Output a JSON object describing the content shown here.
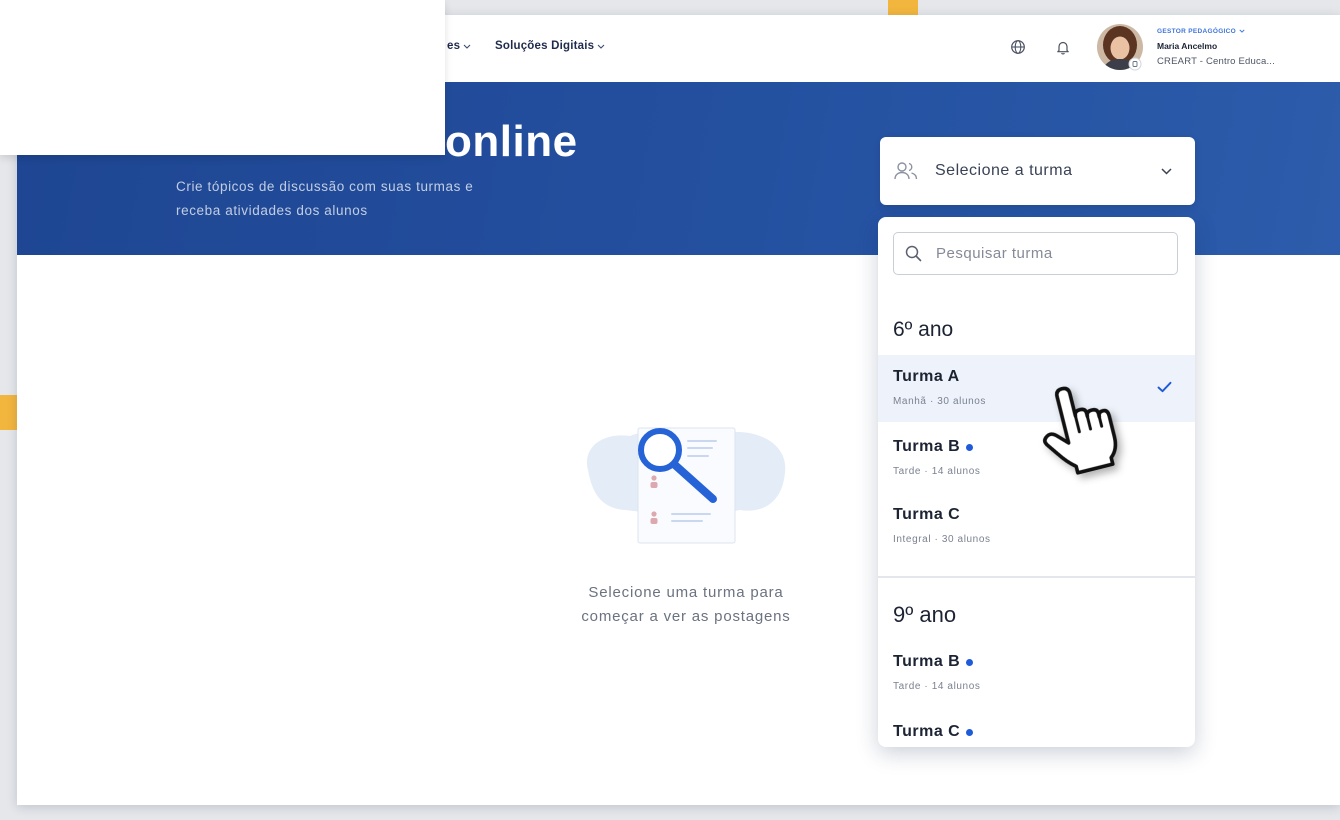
{
  "colors": {
    "page_bg": "#e5e7eb",
    "accent_yellow": "#f2b63e",
    "banner_start": "#1e4692",
    "banner_end": "#2c5cab",
    "accent_blue": "#1e5bd8",
    "selected_row": "#eef3fb",
    "text_dark": "#1c2333",
    "text_muted": "#7b8190"
  },
  "nav": {
    "partial_label": "es",
    "items": [
      {
        "label": "Soluções Digitais"
      }
    ],
    "icons": [
      "globe-icon",
      "bell-icon"
    ],
    "user": {
      "role": "GESTOR PEDAGÓGICO",
      "name": "Maria Ancelmo",
      "org": "CREART - Centro Educa..."
    }
  },
  "banner": {
    "title": "online",
    "subtitle_lines": [
      "Crie tópicos de discussão com suas turmas e",
      "receba atividades dos alunos"
    ]
  },
  "class_select": {
    "icon": "users-icon",
    "placeholder": "Selecione a turma",
    "expanded": true
  },
  "class_dropdown": {
    "search_icon": "search-icon",
    "search_placeholder": "Pesquisar turma",
    "groups": [
      {
        "label": "6º ano",
        "classes": [
          {
            "name": "Turma A",
            "meta": "Manhã · 30 alunos",
            "selected": true,
            "has_update": false
          },
          {
            "name": "Turma B",
            "meta": "Tarde · 14 alunos",
            "selected": false,
            "has_update": true
          },
          {
            "name": "Turma C",
            "meta": "Integral · 30 alunos",
            "selected": false,
            "has_update": false
          }
        ]
      },
      {
        "label": "9º ano",
        "classes": [
          {
            "name": "Turma B",
            "meta": "Tarde · 14 alunos",
            "selected": false,
            "has_update": true
          },
          {
            "name": "Turma C",
            "selected": false,
            "has_update": true
          }
        ]
      }
    ]
  },
  "empty_state": {
    "illustration": "search-document-illustration",
    "message_lines": [
      "Selecione uma turma para",
      "começar a ver as postagens"
    ]
  },
  "cursor": "hand-pointer-cursor"
}
